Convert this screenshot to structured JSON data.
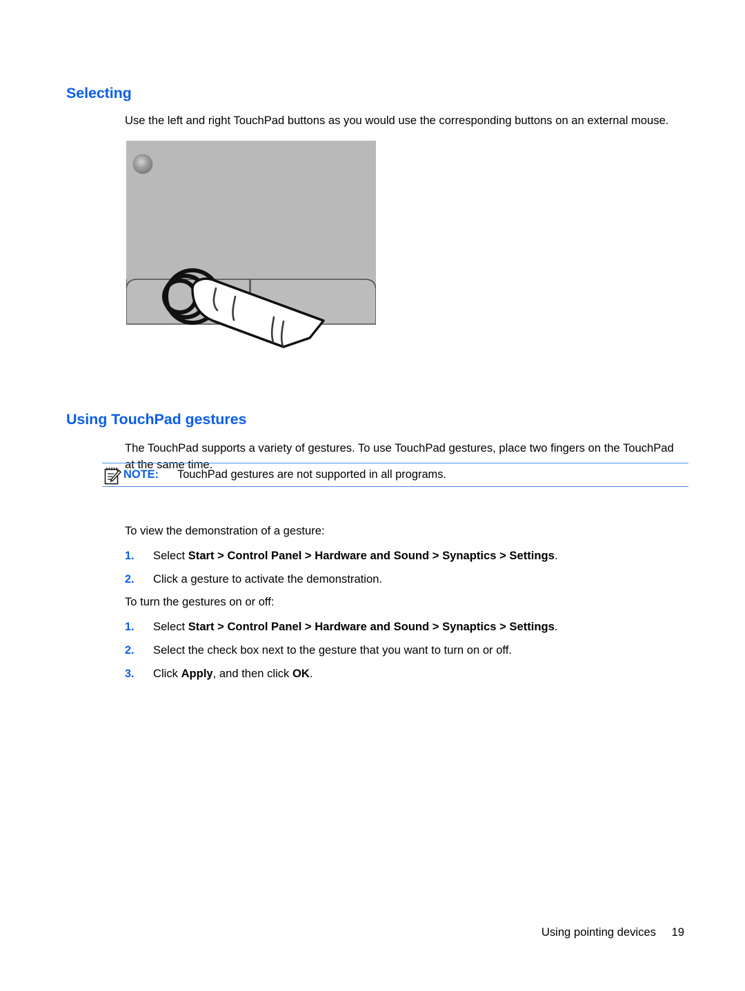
{
  "document": {
    "sections": [
      {
        "id": "selecting",
        "heading": "Selecting",
        "paragraph": "Use the left and right TouchPad buttons as you would use the corresponding buttons on an external mouse."
      },
      {
        "id": "gestures",
        "heading": "Using TouchPad gestures",
        "paragraph": "The TouchPad supports a variety of gestures. To use TouchPad gestures, place two fingers on the TouchPad at the same time."
      }
    ],
    "note": {
      "icon": "note-pencil-icon",
      "label": "NOTE:",
      "text": "TouchPad gestures are not supported in all programs.",
      "rule_color": "#4a90e2",
      "label_color": "#0a5fe6"
    },
    "procedures": [
      {
        "id": "view-demonstration",
        "lead": "To view the demonstration of a gesture:",
        "steps": [
          {
            "number": "1.",
            "parts": [
              {
                "text": "Select ",
                "bold": false
              },
              {
                "text": "Start > Control Panel > Hardware and Sound > Synaptics > Settings",
                "bold": true
              },
              {
                "text": ".",
                "bold": false
              }
            ]
          },
          {
            "number": "2.",
            "parts": [
              {
                "text": "Click a gesture to activate the demonstration.",
                "bold": false
              }
            ]
          }
        ]
      },
      {
        "id": "turn-gestures-on-off",
        "lead": "To turn the gestures on or off:",
        "steps": [
          {
            "number": "1.",
            "parts": [
              {
                "text": "Select ",
                "bold": false
              },
              {
                "text": "Start > Control Panel > Hardware and Sound > Synaptics > Settings",
                "bold": true
              },
              {
                "text": ".",
                "bold": false
              }
            ]
          },
          {
            "number": "2.",
            "parts": [
              {
                "text": "Select the check box next to the gesture that you want to turn on or off.",
                "bold": false
              }
            ]
          },
          {
            "number": "3.",
            "parts": [
              {
                "text": "Click ",
                "bold": false
              },
              {
                "text": "Apply",
                "bold": true
              },
              {
                "text": ", and then click ",
                "bold": false
              },
              {
                "text": "OK",
                "bold": true
              },
              {
                "text": ".",
                "bold": false
              }
            ]
          }
        ]
      }
    ],
    "figure": {
      "name": "touchpad-tap-illustration",
      "description": "TouchPad with indicator light and a finger pressing the left TouchPad button",
      "panel_color": "#b9b9b9",
      "button_color": "#bcbcbc",
      "outline_color": "#4d4d4d",
      "indicator_color": "#8d8d8d"
    },
    "footer": {
      "title": "Using pointing devices",
      "page_number": "19"
    },
    "theme": {
      "heading_blue": "#0a5fe6",
      "text_black": "#000000",
      "page_background": "#ffffff"
    }
  }
}
